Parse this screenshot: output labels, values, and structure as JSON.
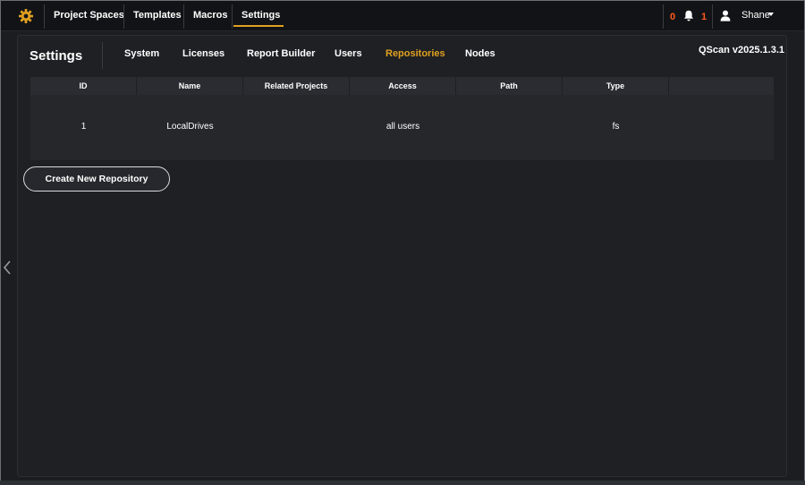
{
  "topbar": {
    "nav": [
      {
        "label": "Project Spaces"
      },
      {
        "label": "Templates"
      },
      {
        "label": "Macros"
      },
      {
        "label": "Settings",
        "active": true
      }
    ],
    "alerts_count": "0",
    "notifications_count": "1",
    "user_name": "Shane",
    "accent_color": "#e0a020",
    "alert_color": "#ff5a1f",
    "icons": [
      "gear-logo-icon",
      "bell-icon",
      "user-icon",
      "chevron-down-icon"
    ]
  },
  "page": {
    "title": "Settings",
    "version": "QScan v2025.1.3.1",
    "tabs": [
      {
        "label": "System"
      },
      {
        "label": "Licenses"
      },
      {
        "label": "Report Builder"
      },
      {
        "label": "Users"
      },
      {
        "label": "Repositories",
        "active": true
      },
      {
        "label": "Nodes"
      }
    ]
  },
  "table": {
    "columns": [
      "ID",
      "Name",
      "Related Projects",
      "Access",
      "Path",
      "Type"
    ],
    "rows": [
      {
        "id": "1",
        "name": "LocalDrives",
        "related_projects": "",
        "access": "all users",
        "path": "",
        "type": "fs"
      }
    ]
  },
  "actions": {
    "create_repository": "Create New Repository"
  },
  "side": {
    "icon": "chevron-left-icon"
  }
}
